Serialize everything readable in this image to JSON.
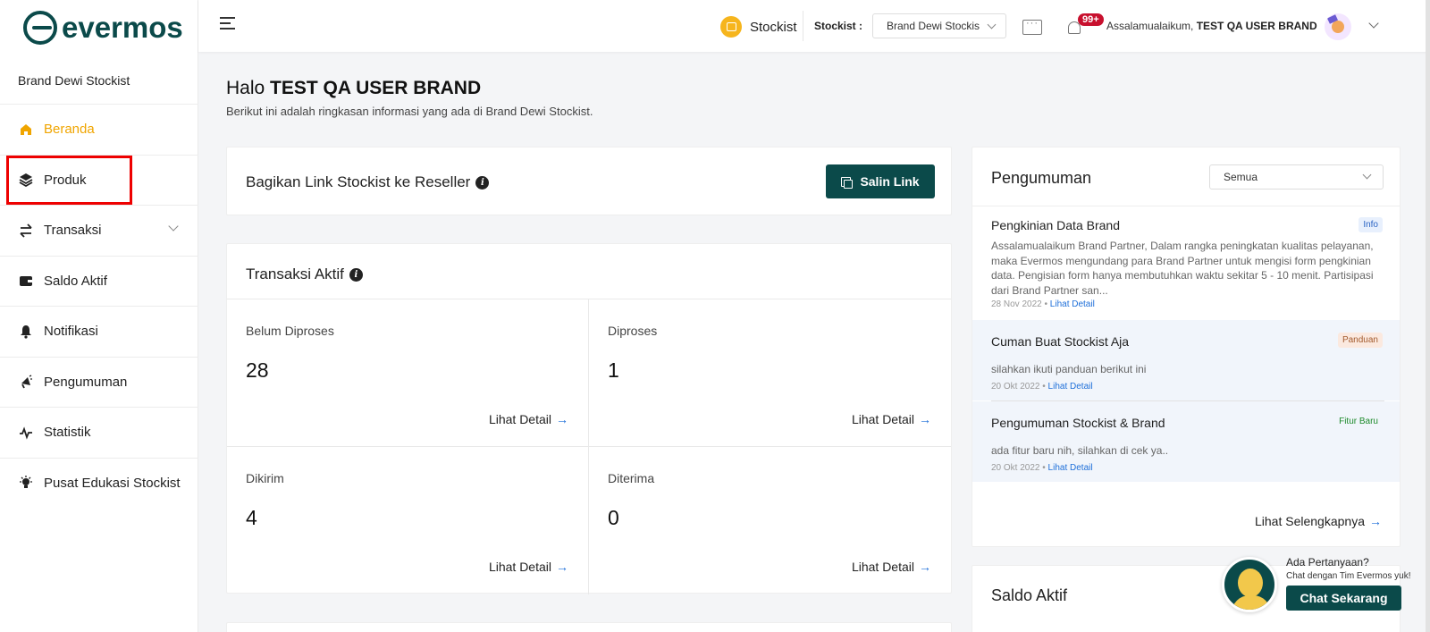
{
  "app": {
    "logo_text": "evermos",
    "store_name": "Brand Dewi Stockist"
  },
  "sidebar": {
    "items": [
      {
        "label": "Beranda",
        "icon": "home-icon",
        "active": true
      },
      {
        "label": "Produk",
        "icon": "layers-icon",
        "active": false
      },
      {
        "label": "Transaksi",
        "icon": "swap-arrows-icon",
        "active": false,
        "has_submenu": true
      },
      {
        "label": "Saldo Aktif",
        "icon": "wallet-icon",
        "active": false
      },
      {
        "label": "Notifikasi",
        "icon": "bell-icon",
        "active": false
      },
      {
        "label": "Pengumuman",
        "icon": "megaphone-icon",
        "active": false
      },
      {
        "label": "Statistik",
        "icon": "activity-icon",
        "active": false
      },
      {
        "label": "Pusat Edukasi Stockist",
        "icon": "lightbulb-icon",
        "active": false
      }
    ]
  },
  "header": {
    "role_label": "Stockist",
    "stockist_label": "Stockist :",
    "stockist_selected": "Brand Dewi Stockis",
    "notif_count": "99+",
    "greeting_prefix": "Assalamualaikum,",
    "user_name": "TEST QA USER BRAND"
  },
  "main": {
    "hello": "Halo",
    "user_name": "TEST QA USER BRAND",
    "subtitle": "Berikut ini adalah ringkasan informasi yang ada di Brand Dewi Stockist."
  },
  "share": {
    "title": "Bagikan Link Stockist ke Reseller",
    "button": "Salin Link"
  },
  "transactions": {
    "title": "Transaksi Aktif",
    "detail_label": "Lihat Detail",
    "cells": [
      {
        "label": "Belum Diproses",
        "value": "28"
      },
      {
        "label": "Diproses",
        "value": "1"
      },
      {
        "label": "Dikirim",
        "value": "4"
      },
      {
        "label": "Diterima",
        "value": "0"
      }
    ]
  },
  "announcements": {
    "title": "Pengumuman",
    "filter": "Semua",
    "more": "Lihat Selengkapnya",
    "detail_label": "Lihat Detail",
    "items": [
      {
        "title": "Pengkinian Data Brand",
        "badge": "Info",
        "body": "Assalamualaikum Brand Partner, Dalam rangka peningkatan kualitas pelayanan, maka Evermos mengundang para Brand Partner untuk mengisi form pengkinian data. Pengisian form hanya membutuhkan waktu sekitar 5 - 10 menit. Partisipasi dari Brand Partner san...",
        "date": "28 Nov 2022"
      },
      {
        "title": "Cuman Buat Stockist Aja",
        "badge": "Panduan",
        "body": "silahkan ikuti panduan berikut ini",
        "date": "20 Okt 2022"
      },
      {
        "title": "Pengumuman Stockist & Brand",
        "badge": "Fitur Baru",
        "body": "ada fitur baru nih, silahkan di cek ya..",
        "date": "20 Okt 2022"
      }
    ]
  },
  "saldo": {
    "title": "Saldo Aktif"
  },
  "chat_widget": {
    "question": "Ada Pertanyaan?",
    "subtitle": "Chat dengan Tim Evermos yuk!",
    "button": "Chat Sekarang"
  },
  "colors": {
    "brand": "#0b4a4a",
    "active": "#f0a500",
    "link": "#1e6fd9",
    "badge_notif": "#c8102e"
  }
}
